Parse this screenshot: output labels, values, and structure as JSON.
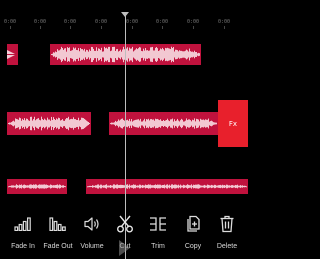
{
  "ruler": {
    "ticks": [
      "0:00",
      "0:00",
      "0:00",
      "0:00",
      "0:00",
      "0:00",
      "0:00",
      "0:00"
    ]
  },
  "fx_button": {
    "label": "Fx"
  },
  "toolbar": {
    "fade_in": "Fade In",
    "fade_out": "Fade Out",
    "volume": "Volume",
    "cut": "Cut",
    "trim": "Trim",
    "copy": "Copy",
    "delete": "Delete"
  },
  "colors": {
    "clip": "#c0123d",
    "waveform": "#f2c8d2",
    "fx_button": "#e8202c",
    "background": "#000000"
  }
}
